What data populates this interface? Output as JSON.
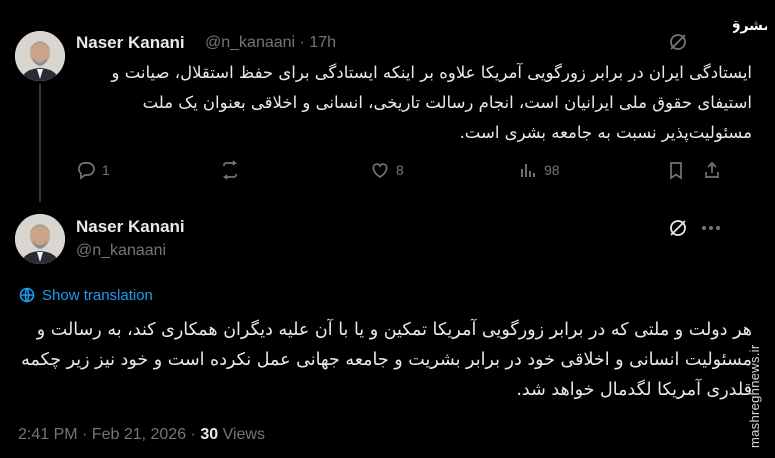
{
  "watermark": {
    "logo_text": "مشرق",
    "site": "mashreghnews.ir"
  },
  "reply_tweet": {
    "author_name": "Naser Kanani",
    "handle": "@n_kanaani",
    "separator": "·",
    "time": "17h",
    "text": "ایستادگی ایران در برابر زورگویی آمریکا علاوه بر اینکه ایستادگی برای حفظ استقلال، صیانت و استیفای حقوق ملی ایرانیان است، انجام رسالت تاریخی، انسانی و اخلاقی بعنوان یک ملت مسئولیت‌پذیر نسبت به جامعه بشری است.",
    "actions": {
      "replies": "1",
      "retweets": "",
      "likes": "8",
      "views": "98"
    }
  },
  "main_tweet": {
    "author_name": "Naser Kanani",
    "handle": "@n_kanaani",
    "show_translation": "Show translation",
    "text": "هر دولت و ملتی که در برابر زورگویی آمریکا تمکین و یا با آن علیه دیگران همکاری کند، به رسالت و مسئولیت انسانی و اخلاقی خود در برابر بشریت و جامعه جهانی عمل نکرده است و خود نیز زیر چکمه قلدری آمریکا لگدمال خواهد شد.",
    "timestamp": "2:41 PM · Feb 21, 2026 · ",
    "views_count": "30",
    "views_label": " Views"
  },
  "colors": {
    "background": "#000000",
    "text": "#e7e9ea",
    "muted": "#71767b",
    "link": "#1d9bf0",
    "line": "#333639"
  },
  "icons": [
    "grok-icon",
    "more-icon",
    "reply-icon",
    "retweet-icon",
    "like-icon",
    "views-icon",
    "bookmark-icon",
    "share-icon",
    "translate-icon"
  ]
}
